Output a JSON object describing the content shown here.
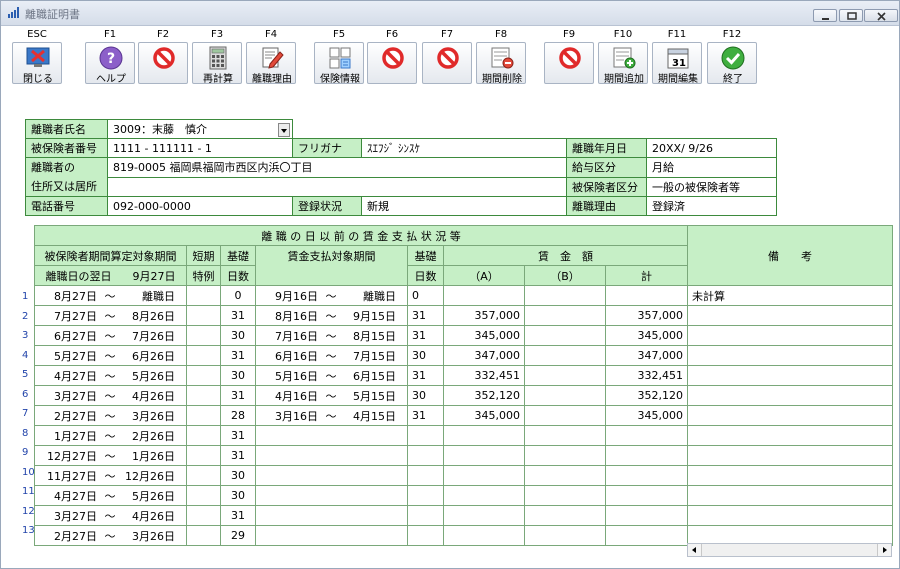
{
  "window": {
    "title": "離職証明書"
  },
  "toolbar": {
    "keys": [
      {
        "key": "ESC",
        "label": "閉じる"
      },
      {
        "key": "F1",
        "label": "ヘルプ"
      },
      {
        "key": "F2",
        "label": ""
      },
      {
        "key": "F3",
        "label": "再計算"
      },
      {
        "key": "F4",
        "label": "離職理由"
      },
      {
        "key": "F5",
        "label": "保険情報"
      },
      {
        "key": "F6",
        "label": ""
      },
      {
        "key": "F7",
        "label": ""
      },
      {
        "key": "F8",
        "label": "期間削除"
      },
      {
        "key": "F9",
        "label": ""
      },
      {
        "key": "F10",
        "label": "期間追加"
      },
      {
        "key": "F11",
        "label": "期間編集"
      },
      {
        "key": "F12",
        "label": "終了"
      }
    ],
    "calendar_icon_text": "31"
  },
  "employee": {
    "name_label": "離職者氏名",
    "name_value": "3009：末藤　慎介",
    "insured_no_label": "被保険者番号",
    "insured_no_value": "1111 - 111111 - 1",
    "kana_label": "フリガナ",
    "kana_value": "ｽｴﾌｼﾞ ｼﾝｽｹ",
    "separation_date_label": "離職年月日",
    "separation_date_value": "20XX/ 9/26",
    "address_label_1": "離職者の",
    "address_label_2": "住所又は居所",
    "address_value": "819-0005 福岡県福岡市西区内浜〇丁目",
    "address_value_2": "",
    "pay_type_label": "給与区分",
    "pay_type_value": "月給",
    "insured_type_label": "被保険者区分",
    "insured_type_value": "一般の被保険者等",
    "phone_label": "電話番号",
    "phone_value": "092-000-0000",
    "status_label": "登録状況",
    "status_value": "新規",
    "reason_label": "離職理由",
    "reason_value": "登録済"
  },
  "wages": {
    "section_title": "離 職 の 日 以 前 の 賃 金 支 払 状 況 等",
    "col_period_1": "被保険者期間算定対象期間",
    "col_period_2a": "離職日の翌日",
    "col_period_2b": "9月27日",
    "col_short_1": "短期",
    "col_short_2": "特例",
    "col_base_1": "基礎",
    "col_base_2": "日数",
    "col_pay_period": "賃金支払対象期間",
    "col_pay_base_1": "基礎",
    "col_pay_base_2": "日数",
    "col_amount": "賃　金　額",
    "col_a": "（A）",
    "col_b": "（B）",
    "col_total": "計",
    "col_remarks": "備　　考",
    "rows": [
      {
        "no": "1",
        "from": "8月27日",
        "to": "離職日",
        "short": "",
        "days": "0",
        "pay_from": "9月16日",
        "pay_to": "離職日",
        "pay_days": "0",
        "a": "",
        "b": "",
        "total": "",
        "remarks": "未計算"
      },
      {
        "no": "2",
        "from": "7月27日",
        "to": "8月26日",
        "short": "",
        "days": "31",
        "pay_from": "8月16日",
        "pay_to": "9月15日",
        "pay_days": "31",
        "a": "357,000",
        "b": "",
        "total": "357,000",
        "remarks": ""
      },
      {
        "no": "3",
        "from": "6月27日",
        "to": "7月26日",
        "short": "",
        "days": "30",
        "pay_from": "7月16日",
        "pay_to": "8月15日",
        "pay_days": "31",
        "a": "345,000",
        "b": "",
        "total": "345,000",
        "remarks": ""
      },
      {
        "no": "4",
        "from": "5月27日",
        "to": "6月26日",
        "short": "",
        "days": "31",
        "pay_from": "6月16日",
        "pay_to": "7月15日",
        "pay_days": "30",
        "a": "347,000",
        "b": "",
        "total": "347,000",
        "remarks": ""
      },
      {
        "no": "5",
        "from": "4月27日",
        "to": "5月26日",
        "short": "",
        "days": "30",
        "pay_from": "5月16日",
        "pay_to": "6月15日",
        "pay_days": "31",
        "a": "332,451",
        "b": "",
        "total": "332,451",
        "remarks": ""
      },
      {
        "no": "6",
        "from": "3月27日",
        "to": "4月26日",
        "short": "",
        "days": "31",
        "pay_from": "4月16日",
        "pay_to": "5月15日",
        "pay_days": "30",
        "a": "352,120",
        "b": "",
        "total": "352,120",
        "remarks": ""
      },
      {
        "no": "7",
        "from": "2月27日",
        "to": "3月26日",
        "short": "",
        "days": "28",
        "pay_from": "3月16日",
        "pay_to": "4月15日",
        "pay_days": "31",
        "a": "345,000",
        "b": "",
        "total": "345,000",
        "remarks": ""
      },
      {
        "no": "8",
        "from": "1月27日",
        "to": "2月26日",
        "short": "",
        "days": "31",
        "pay_from": "",
        "pay_to": "",
        "pay_days": "",
        "a": "",
        "b": "",
        "total": "",
        "remarks": ""
      },
      {
        "no": "9",
        "from": "12月27日",
        "to": "1月26日",
        "short": "",
        "days": "31",
        "pay_from": "",
        "pay_to": "",
        "pay_days": "",
        "a": "",
        "b": "",
        "total": "",
        "remarks": ""
      },
      {
        "no": "10",
        "from": "11月27日",
        "to": "12月26日",
        "short": "",
        "days": "30",
        "pay_from": "",
        "pay_to": "",
        "pay_days": "",
        "a": "",
        "b": "",
        "total": "",
        "remarks": ""
      },
      {
        "no": "11",
        "from": "4月27日",
        "to": "5月26日",
        "short": "",
        "days": "30",
        "pay_from": "",
        "pay_to": "",
        "pay_days": "",
        "a": "",
        "b": "",
        "total": "",
        "remarks": ""
      },
      {
        "no": "12",
        "from": "3月27日",
        "to": "4月26日",
        "short": "",
        "days": "31",
        "pay_from": "",
        "pay_to": "",
        "pay_days": "",
        "a": "",
        "b": "",
        "total": "",
        "remarks": ""
      },
      {
        "no": "13",
        "from": "2月27日",
        "to": "3月26日",
        "short": "",
        "days": "29",
        "pay_from": "",
        "pay_to": "",
        "pay_days": "",
        "a": "",
        "b": "",
        "total": "",
        "remarks": ""
      }
    ],
    "tilde": "～"
  },
  "colors": {
    "header_green": "#c6efc6",
    "border_green": "#3d8a3d",
    "row_number_blue": "#2244aa"
  }
}
